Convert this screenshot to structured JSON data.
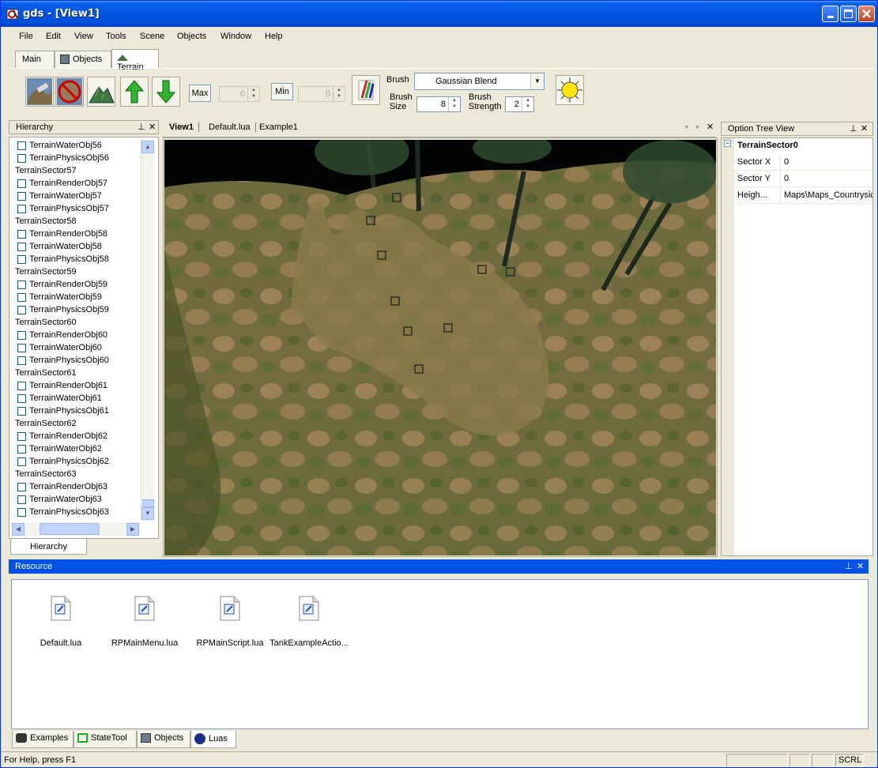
{
  "window": {
    "title": "gds - [View1]"
  },
  "menu": [
    "File",
    "Edit",
    "View",
    "Tools",
    "Scene",
    "Objects",
    "Window",
    "Help"
  ],
  "top_tabs": [
    {
      "label": "Main"
    },
    {
      "label": "Objects"
    },
    {
      "label": "Terrain"
    }
  ],
  "toolbar": {
    "max_label": "Max",
    "max_value": "0",
    "min_label": "Min",
    "min_value": "0",
    "brush_label": "Brush",
    "brush_value": "Gaussian Blend",
    "brush_size_label": "Brush\nSize",
    "brush_size_value": "8",
    "brush_strength_label": "Brush\nStrength",
    "brush_strength_value": "2"
  },
  "hierarchy": {
    "title": "Hierarchy",
    "items": [
      {
        "label": "TerrainWaterObj56",
        "checkbox": true
      },
      {
        "label": "TerrainPhysicsObj56",
        "checkbox": true
      },
      {
        "label": "TerrainSector57",
        "checkbox": false
      },
      {
        "label": "TerrainRenderObj57",
        "checkbox": true
      },
      {
        "label": "TerrainWaterObj57",
        "checkbox": true
      },
      {
        "label": "TerrainPhysicsObj57",
        "checkbox": true
      },
      {
        "label": "TerrainSector58",
        "checkbox": false
      },
      {
        "label": "TerrainRenderObj58",
        "checkbox": true
      },
      {
        "label": "TerrainWaterObj58",
        "checkbox": true
      },
      {
        "label": "TerrainPhysicsObj58",
        "checkbox": true
      },
      {
        "label": "TerrainSector59",
        "checkbox": false
      },
      {
        "label": "TerrainRenderObj59",
        "checkbox": true
      },
      {
        "label": "TerrainWaterObj59",
        "checkbox": true
      },
      {
        "label": "TerrainPhysicsObj59",
        "checkbox": true
      },
      {
        "label": "TerrainSector60",
        "checkbox": false
      },
      {
        "label": "TerrainRenderObj60",
        "checkbox": true
      },
      {
        "label": "TerrainWaterObj60",
        "checkbox": true
      },
      {
        "label": "TerrainPhysicsObj60",
        "checkbox": true
      },
      {
        "label": "TerrainSector61",
        "checkbox": false
      },
      {
        "label": "TerrainRenderObj61",
        "checkbox": true
      },
      {
        "label": "TerrainWaterObj61",
        "checkbox": true
      },
      {
        "label": "TerrainPhysicsObj61",
        "checkbox": true
      },
      {
        "label": "TerrainSector62",
        "checkbox": false
      },
      {
        "label": "TerrainRenderObj62",
        "checkbox": true
      },
      {
        "label": "TerrainWaterObj62",
        "checkbox": true
      },
      {
        "label": "TerrainPhysicsObj62",
        "checkbox": true
      },
      {
        "label": "TerrainSector63",
        "checkbox": false
      },
      {
        "label": "TerrainRenderObj63",
        "checkbox": true
      },
      {
        "label": "TerrainWaterObj63",
        "checkbox": true
      },
      {
        "label": "TerrainPhysicsObj63",
        "checkbox": true
      }
    ],
    "bottom_tab": "Hierarchy"
  },
  "doc_tabs": [
    "View1",
    "Default.lua",
    "Example1"
  ],
  "option_tree": {
    "title": "Option Tree View",
    "root": "TerrainSector0",
    "props": [
      {
        "key": "Sector X",
        "value": "0"
      },
      {
        "key": "Sector Y",
        "value": "0"
      },
      {
        "key": "Heigh...",
        "value": "Maps\\Maps_Countryside"
      }
    ]
  },
  "resource": {
    "title": "Resource",
    "files": [
      "Default.lua",
      "RPMainMenu.lua",
      "RPMainScript.lua",
      "TankExampleActio..."
    ]
  },
  "bottom_tabs": [
    {
      "label": "Examples"
    },
    {
      "label": "StateTool"
    },
    {
      "label": "Objects"
    },
    {
      "label": "Luas"
    }
  ],
  "status": {
    "text": "For Help, press F1",
    "indicator": "SCRL"
  }
}
